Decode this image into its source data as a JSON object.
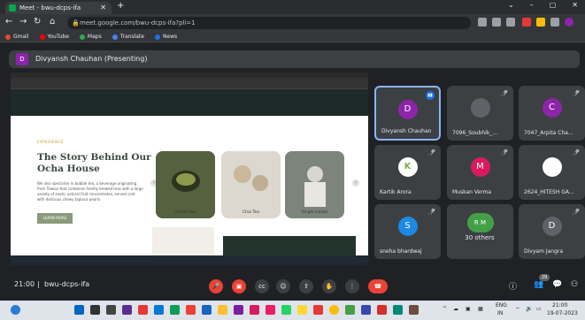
{
  "browser": {
    "tab_title": "Meet - bwu-dcps-ifa",
    "tab_close": "✕",
    "new_tab": "+",
    "url": "meet.google.com/bwu-dcps-ifa?pli=1",
    "window_controls": [
      "⌄",
      "–",
      "▢",
      "✕"
    ],
    "bookmarks": [
      "Gmail",
      "YouTube",
      "Maps",
      "Translate",
      "News"
    ]
  },
  "meet": {
    "presenting_avatar": "D",
    "presenting_text": "Divyansh Chauhan (Presenting)",
    "meeting_time": "21:00",
    "meeting_code": "bwu-dcps-ifa",
    "divider": "|",
    "participant_count": "29"
  },
  "shared_screen": {
    "eyebrow": "EXPERIENCE",
    "title": "The Story Behind Our Ocha House",
    "body": "We also specialise in bubble tea, a beverage originating from Taiwan that combines freshly brewed teas with a large variety of exotic natural fruit concentrates, served cold with delicious chewy tapioca pearls.",
    "button": "LEARN MORE",
    "cards": [
      "Green Tea",
      "Chai Tea",
      "Single Estate"
    ]
  },
  "participants": [
    {
      "initial": "D",
      "name": "Divyansh Chauhan",
      "color": "#8e24aa"
    },
    {
      "initial": "",
      "name": "7096_Soubhik_...",
      "color": "#5f6368"
    },
    {
      "initial": "C",
      "name": "7047_Arpita Cha...",
      "color": "#8e24aa"
    },
    {
      "initial": "K",
      "name": "Kartik Arora",
      "color": "#ffffff"
    },
    {
      "initial": "M",
      "name": "Muskan Verma",
      "color": "#d81b60"
    },
    {
      "initial": "",
      "name": "2624_HITESH GA...",
      "color": "#ffffff"
    },
    {
      "initial": "S",
      "name": "sneha bhardwaj",
      "color": "#1e88e5"
    },
    {
      "initial": "R M",
      "name": "30 others",
      "color": "#43a047"
    },
    {
      "initial": "D",
      "name": "Divyam Jangra",
      "color": "#3c4043"
    }
  ],
  "taskbar": {
    "lang": "ENG",
    "region": "IN",
    "time": "21:00",
    "date": "19-07-2023"
  },
  "colors": {
    "end_call": "#ea4335",
    "meet_bg": "#202124",
    "tile_bg": "#3c4043",
    "accent_blue": "#1a73e8"
  }
}
